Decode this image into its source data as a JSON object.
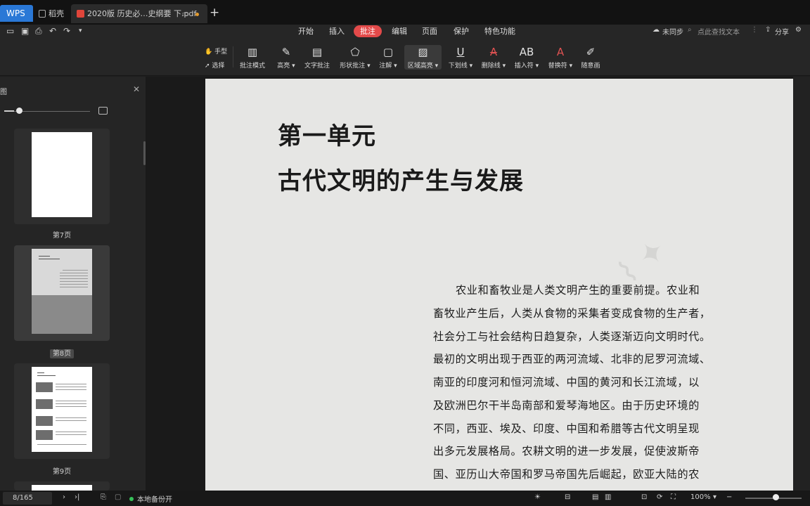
{
  "tabs": {
    "wps": "WPS",
    "store": "稻壳",
    "document": "2020版 历史必…史纲要 下.pdf"
  },
  "menu": {
    "items": [
      "开始",
      "插入",
      "批注",
      "编辑",
      "页面",
      "保护",
      "特色功能"
    ],
    "active": "批注",
    "sync": "未同步",
    "search_placeholder": "点此查找文本",
    "share": "分享"
  },
  "toolbar": {
    "hand": "手型",
    "select": "选择",
    "tools": [
      {
        "label": "批注模式",
        "icon": "annotation-mode-icon"
      },
      {
        "label": "高亮",
        "icon": "highlight-icon"
      },
      {
        "label": "文字批注",
        "icon": "text-annotation-icon"
      },
      {
        "label": "形状批注",
        "icon": "shape-annotation-icon"
      },
      {
        "label": "注解",
        "icon": "note-icon"
      },
      {
        "label": "区域高亮",
        "icon": "area-highlight-icon"
      },
      {
        "label": "下划线",
        "icon": "underline-icon"
      },
      {
        "label": "删除线",
        "icon": "strikethrough-icon"
      },
      {
        "label": "插入符",
        "icon": "insert-caret-icon"
      },
      {
        "label": "替换符",
        "icon": "replace-caret-icon"
      },
      {
        "label": "随意画",
        "icon": "freehand-icon"
      }
    ]
  },
  "sidebar": {
    "title": "图",
    "thumbnails": [
      {
        "label": "第7页"
      },
      {
        "label": "第8页",
        "current": true
      },
      {
        "label": "第9页"
      }
    ]
  },
  "page": {
    "unit": "第一单元",
    "title": "古代文明的产生与发展",
    "lines": [
      "农业和畜牧业是人类文明产生的重要前提。农业和",
      "畜牧业产生后，人类从食物的采集者变成食物的生产者，",
      "社会分工与社会结构日趋复杂，人类逐渐迈向文明时代。",
      "最初的文明出现于西亚的两河流域、北非的尼罗河流域、",
      "南亚的印度河和恒河流域、中国的黄河和长江流域，以",
      "及欧洲巴尔干半岛南部和爱琴海地区。由于历史环境的",
      "不同，西亚、埃及、印度、中国和希腊等古代文明呈现",
      "出多元发展格局。农耕文明的进一步发展，促使波斯帝",
      "国、亚历山大帝国和罗马帝国先后崛起，欧亚大陆的农"
    ]
  },
  "status": {
    "page_indicator": "8/165",
    "backup": "本地备份开",
    "zoom": "100%"
  }
}
